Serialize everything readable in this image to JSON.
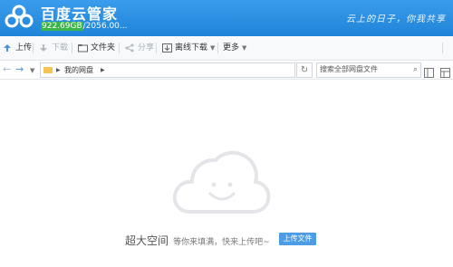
{
  "header": {
    "app_title": "百度云管家",
    "quota_used": "922.69GB",
    "quota_rest": "/2056.00...",
    "slogan": "云上的日子，你我共享",
    "colors": {
      "header_bg": "#2a8fe2",
      "quota_green": "#3bb54a"
    }
  },
  "toolbar": {
    "upload": "上传",
    "download": "下载",
    "folder": "文件夹",
    "share": "分享",
    "offline": "离线下载",
    "more": "更多"
  },
  "address": {
    "path": "我的网盘",
    "search_placeholder": "搜索全部网盘文件"
  },
  "empty": {
    "big_text": "超大空间",
    "small_text": "等你来填满，快来上传吧~",
    "upload_button": "上传文件"
  }
}
